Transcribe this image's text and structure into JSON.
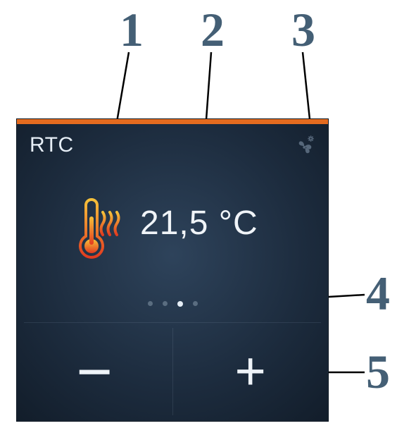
{
  "callouts": {
    "n1": "1",
    "n2": "2",
    "n3": "3",
    "n4": "4",
    "n5": "5"
  },
  "panel": {
    "title": "RTC",
    "temperature": "21,5 °C",
    "page_count": 4,
    "active_page_index": 2,
    "minus_label": "−",
    "plus_label": "+",
    "colors": {
      "accent": "#e46b1f",
      "bg_center": "#2e435b",
      "bg_edge": "#121d2a"
    }
  },
  "icons": {
    "thermometer_heating": "thermometer-heat-icon",
    "fan_mode": "fan-settings-icon"
  }
}
